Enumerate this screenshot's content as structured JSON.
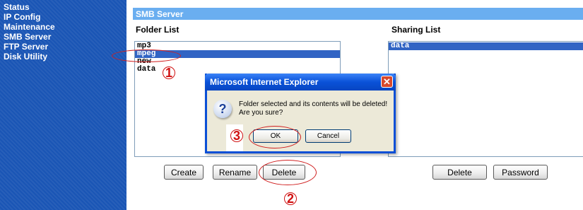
{
  "sidebar": {
    "items": [
      {
        "label": "Status"
      },
      {
        "label": "IP Config"
      },
      {
        "label": "Maintenance"
      },
      {
        "label": "SMB Server"
      },
      {
        "label": "FTP Server"
      },
      {
        "label": "Disk Utility"
      }
    ]
  },
  "panel": {
    "title": "SMB Server",
    "folder_list_label": "Folder List",
    "sharing_list_label": "Sharing List",
    "folders": [
      "mp3",
      "mpeg",
      "new",
      "data"
    ],
    "selected_folder": "mpeg",
    "shares": [
      "data"
    ],
    "buttons": {
      "create": "Create",
      "rename": "Rename",
      "delete": "Delete",
      "share_delete": "Delete",
      "password": "Password"
    }
  },
  "dialog": {
    "title": "Microsoft Internet Explorer",
    "close_glyph": "✕",
    "icon": "question-icon",
    "message_line1": "Folder selected and its contents will be deleted!",
    "message_line2": "Are you sure?",
    "ok_label": "OK",
    "cancel_label": "Cancel"
  },
  "annotations": {
    "step1": "1",
    "step2": "2",
    "step3": "3",
    "color": "#d01010"
  },
  "colors": {
    "sidebar": "#1a55b5",
    "header": "#6aaef0",
    "selection": "#3164c4",
    "dialog_title": "#0a52d8"
  }
}
